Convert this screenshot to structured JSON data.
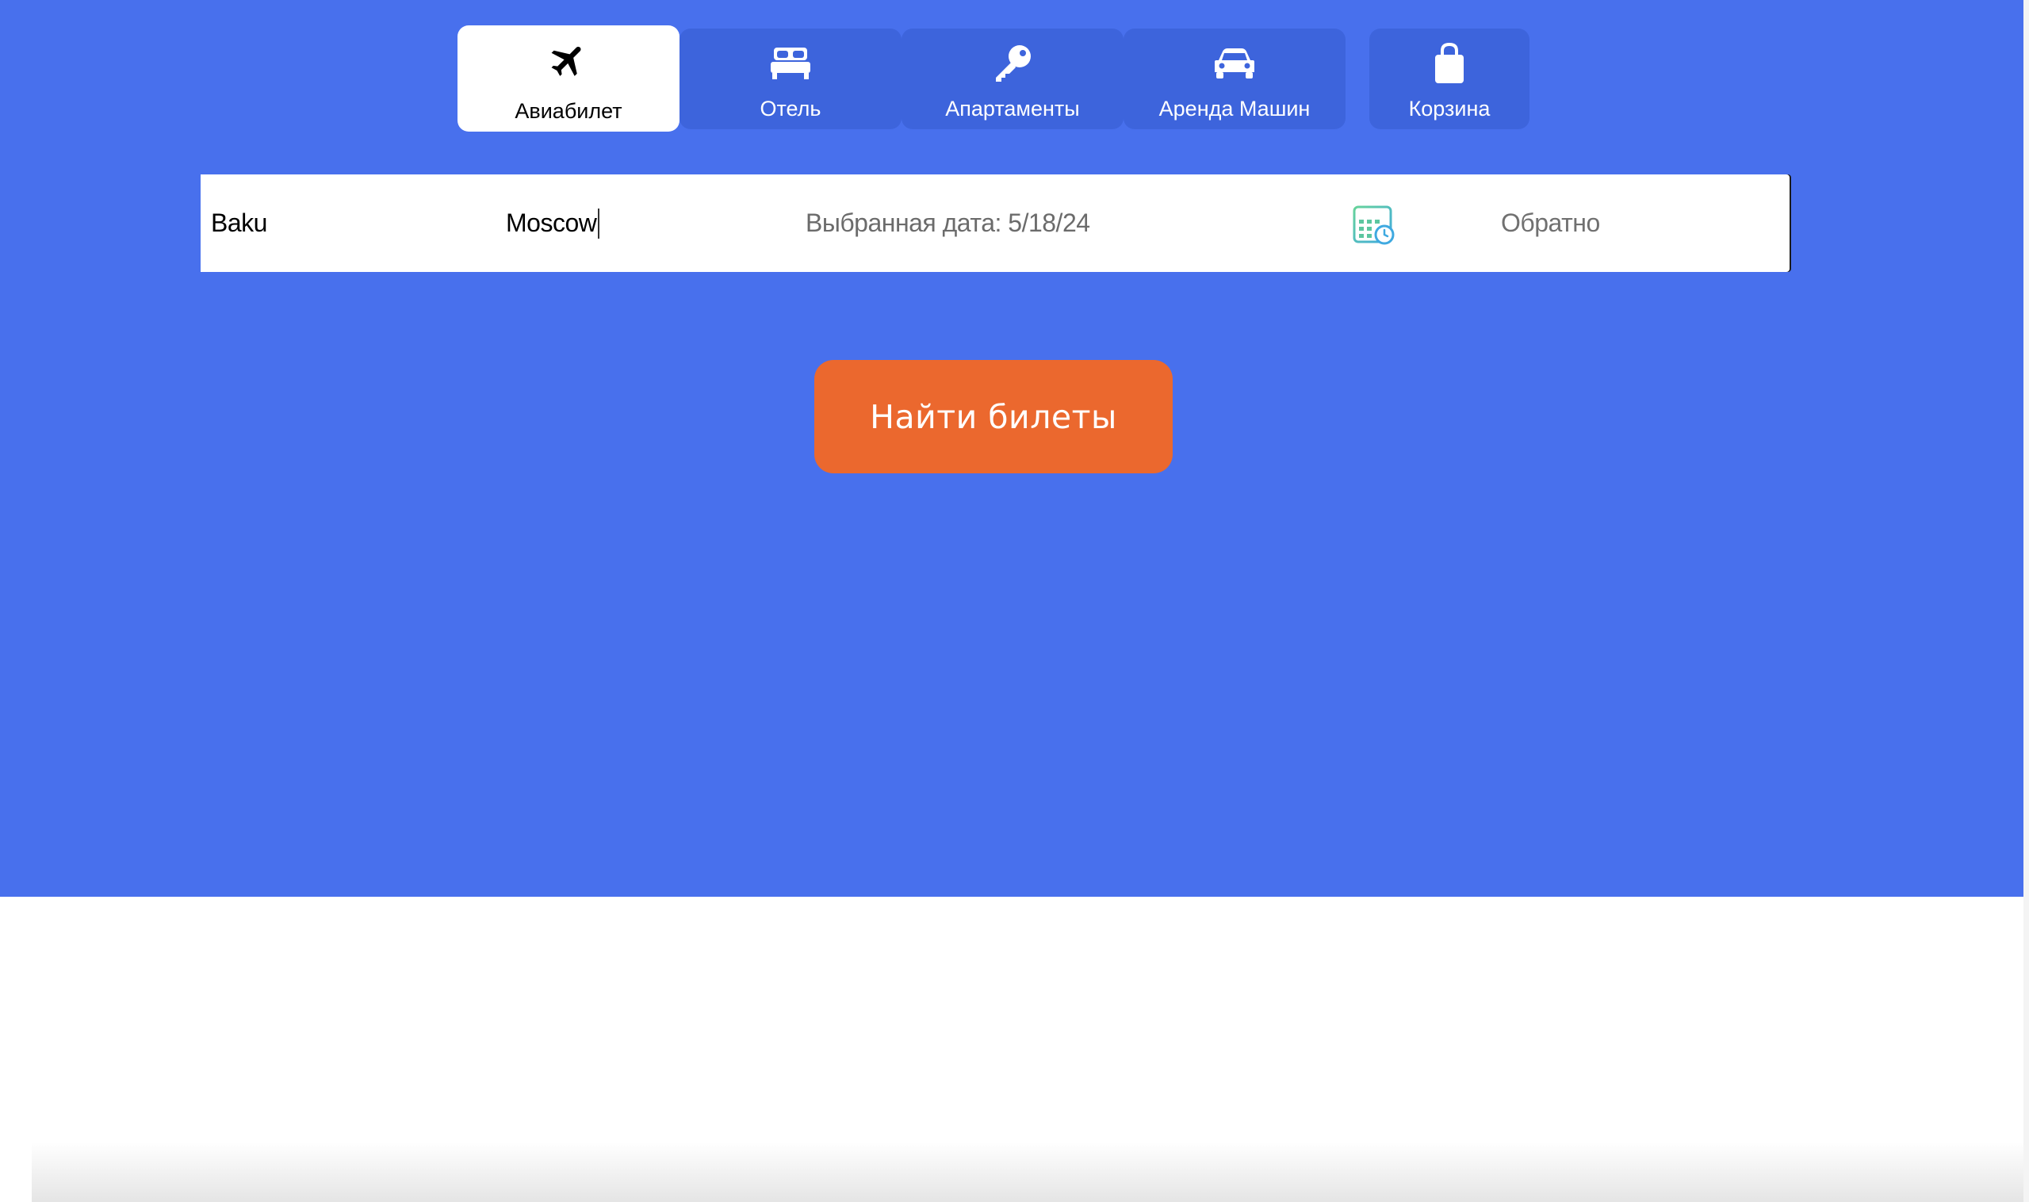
{
  "tabs": [
    {
      "label": "Авиабилет",
      "icon": "airplane-icon",
      "active": true
    },
    {
      "label": "Отель",
      "icon": "bed-icon",
      "active": false
    },
    {
      "label": "Апартаменты",
      "icon": "key-icon",
      "active": false
    },
    {
      "label": "Аренда Машин",
      "icon": "car-icon",
      "active": false
    },
    {
      "label": "Корзина",
      "icon": "shopping-bag-icon",
      "active": false
    }
  ],
  "search": {
    "from_value": "Baku",
    "to_value": "Moscow",
    "date_text": "Выбранная дата: 5/18/24",
    "return_placeholder": "Обратно",
    "calendar_icon": "calendar-clock-icon"
  },
  "search_button": {
    "label": "Найти билеты"
  },
  "colors": {
    "background": "#4870ed",
    "tab_inactive": "#3d64dc",
    "tab_active": "#ffffff",
    "button": "#eb682e",
    "calendar_accent": "#5cc6a0"
  }
}
